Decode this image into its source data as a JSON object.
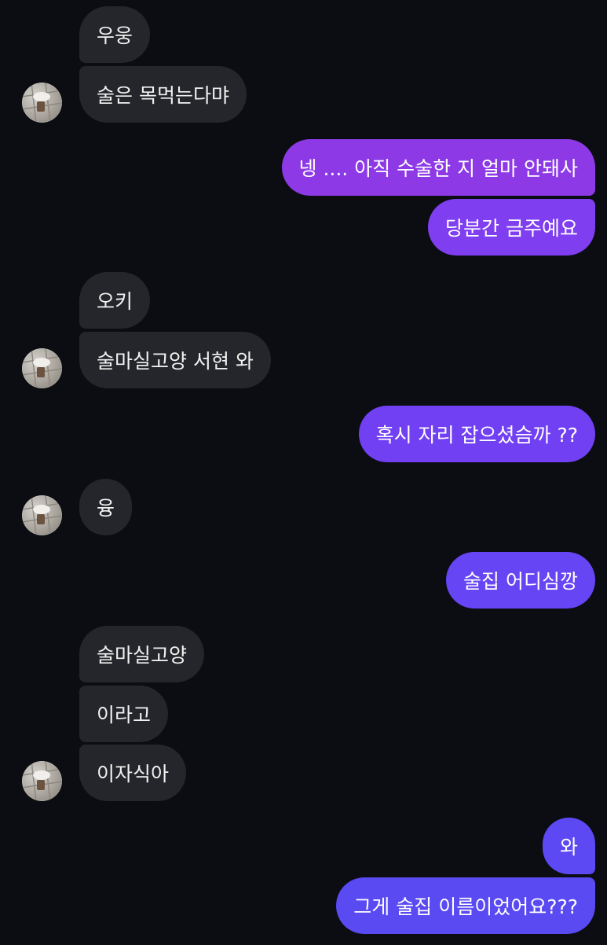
{
  "messages": [
    {
      "from": "them",
      "text": "우웅"
    },
    {
      "from": "them",
      "text": "술은 목먹는다먀"
    },
    {
      "from": "me",
      "text": "넹 .... 아직 수술한 지 얼마 안돼사"
    },
    {
      "from": "me",
      "text": "당분간 금주예요"
    },
    {
      "from": "them",
      "text": "오키"
    },
    {
      "from": "them",
      "text": "술마실고양 서현 와"
    },
    {
      "from": "me",
      "text": "혹시 자리 잡으셨슴까 ??"
    },
    {
      "from": "them",
      "text": "융"
    },
    {
      "from": "me",
      "text": "술집 어디심깡"
    },
    {
      "from": "them",
      "text": "술마실고양"
    },
    {
      "from": "them",
      "text": "이라고"
    },
    {
      "from": "them",
      "text": "이자식아"
    },
    {
      "from": "me",
      "text": "와"
    },
    {
      "from": "me",
      "text": "그게 술집 이름이었어요???"
    }
  ],
  "colors": {
    "background": "#0b0d12",
    "incoming_bubble": "#25262b",
    "outgoing_gradient_top": "#9a3ae0",
    "outgoing_gradient_bottom": "#5b49f2"
  },
  "avatar_icon": "sticker-avatar-icon"
}
